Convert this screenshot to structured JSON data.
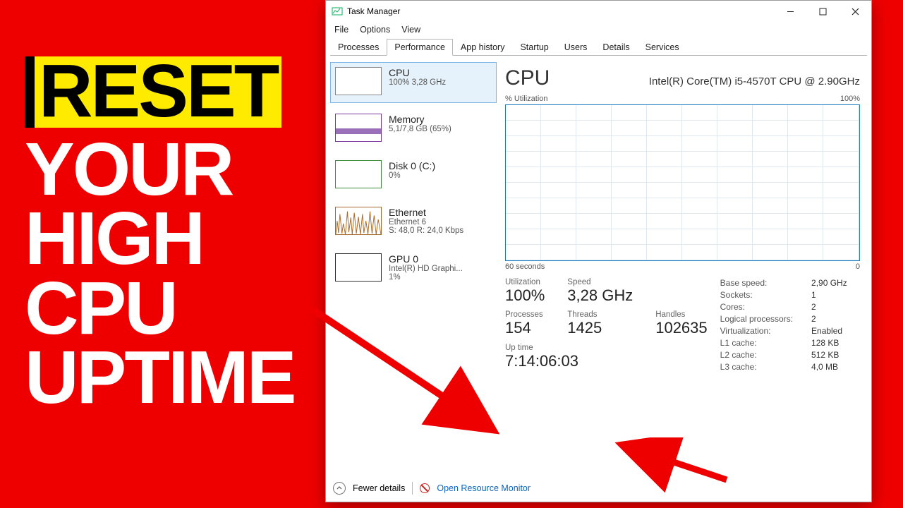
{
  "headline": {
    "l1": "RESET",
    "l2": "YOUR",
    "l3": "HIGH",
    "l4": "CPU",
    "l5": "UPTIME"
  },
  "window": {
    "title": "Task Manager"
  },
  "menubar": {
    "file": "File",
    "options": "Options",
    "view": "View"
  },
  "tabs": {
    "processes": "Processes",
    "performance": "Performance",
    "apphistory": "App history",
    "startup": "Startup",
    "users": "Users",
    "details": "Details",
    "services": "Services"
  },
  "sidebar": {
    "cpu": {
      "title": "CPU",
      "sub": "100% 3,28 GHz"
    },
    "memory": {
      "title": "Memory",
      "sub": "5,1/7,8 GB (65%)"
    },
    "disk": {
      "title": "Disk 0 (C:)",
      "sub": "0%"
    },
    "eth": {
      "title": "Ethernet",
      "sub1": "Ethernet 6",
      "sub2": "S: 48,0 R: 24,0 Kbps"
    },
    "gpu": {
      "title": "GPU 0",
      "sub1": "Intel(R) HD Graphi...",
      "sub2": "1%"
    }
  },
  "main": {
    "title": "CPU",
    "model": "Intel(R) Core(TM) i5-4570T CPU @ 2.90GHz",
    "chart_top_left": "% Utilization",
    "chart_top_right": "100%",
    "chart_bottom_left": "60 seconds",
    "chart_bottom_right": "0",
    "stats": {
      "utilization_lbl": "Utilization",
      "utilization_val": "100%",
      "speed_lbl": "Speed",
      "speed_val": "3,28 GHz",
      "processes_lbl": "Processes",
      "processes_val": "154",
      "threads_lbl": "Threads",
      "threads_val": "1425",
      "handles_lbl": "Handles",
      "handles_val": "102635",
      "uptime_lbl": "Up time",
      "uptime_val": "7:14:06:03"
    },
    "right": {
      "base_lbl": "Base speed:",
      "base_val": "2,90 GHz",
      "sockets_lbl": "Sockets:",
      "sockets_val": "1",
      "cores_lbl": "Cores:",
      "cores_val": "2",
      "lp_lbl": "Logical processors:",
      "lp_val": "2",
      "virt_lbl": "Virtualization:",
      "virt_val": "Enabled",
      "l1_lbl": "L1 cache:",
      "l1_val": "128 KB",
      "l2_lbl": "L2 cache:",
      "l2_val": "512 KB",
      "l3_lbl": "L3 cache:",
      "l3_val": "4,0 MB"
    }
  },
  "footer": {
    "fewer": "Fewer details",
    "orm": "Open Resource Monitor"
  }
}
